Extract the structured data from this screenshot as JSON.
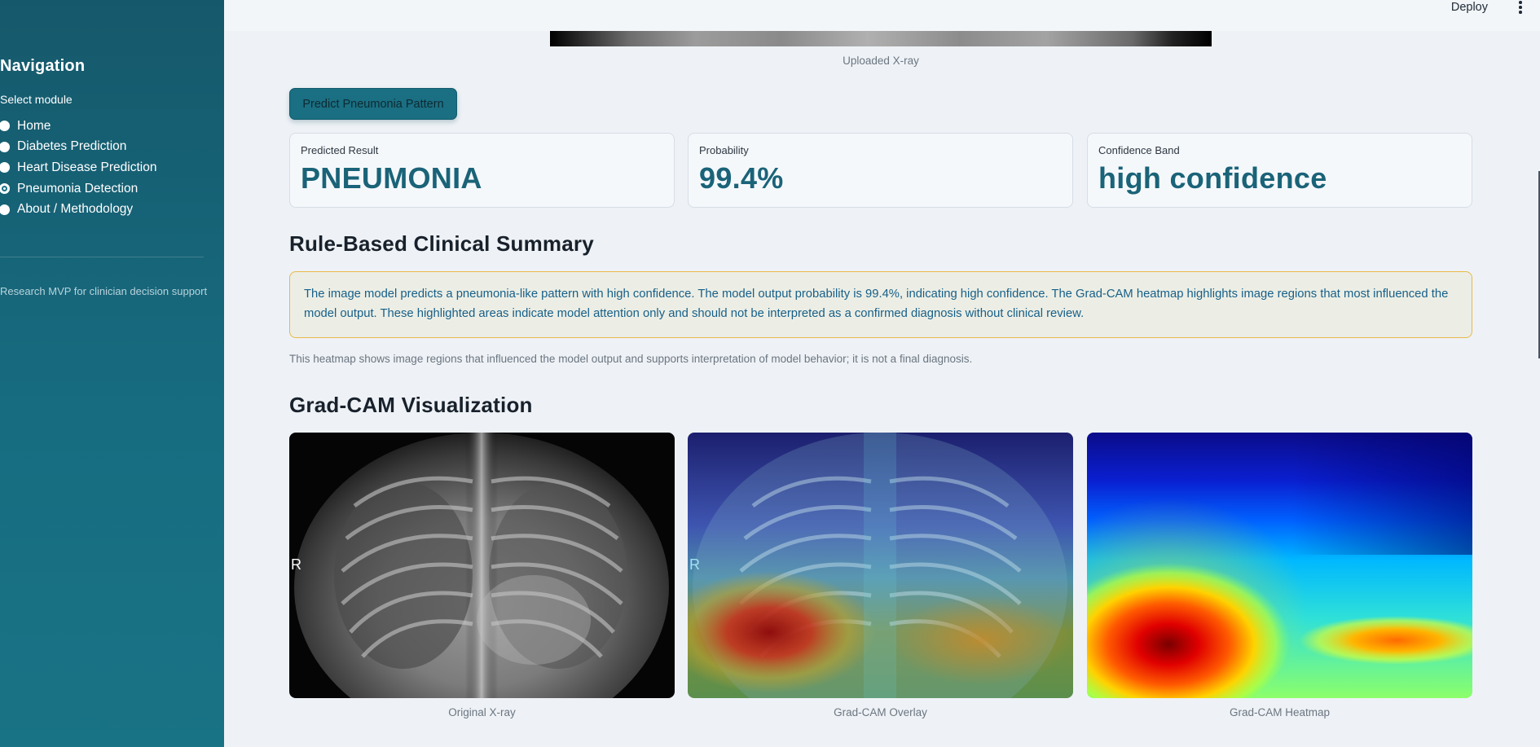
{
  "sidebar": {
    "title": "Navigation",
    "select_label": "Select module",
    "items": [
      {
        "label": "Home",
        "selected": false
      },
      {
        "label": "Diabetes Prediction",
        "selected": false
      },
      {
        "label": "Heart Disease Prediction",
        "selected": false
      },
      {
        "label": "Pneumonia Detection",
        "selected": true
      },
      {
        "label": "About / Methodology",
        "selected": false
      }
    ],
    "note": "Research MVP for clinician decision support"
  },
  "topbar": {
    "deploy_label": "Deploy",
    "menu_icon": "kebab-menu-icon"
  },
  "upload": {
    "caption": "Uploaded X-ray"
  },
  "predict_button": "Predict Pneumonia Pattern",
  "metrics": [
    {
      "label": "Predicted Result",
      "value": "PNEUMONIA"
    },
    {
      "label": "Probability",
      "value": "99.4%"
    },
    {
      "label": "Confidence Band",
      "value": "high confidence"
    }
  ],
  "summary": {
    "title": "Rule-Based Clinical Summary",
    "text": "The image model predicts a pneumonia-like pattern with high confidence. The model output probability is 99.4%, indicating high confidence. The Grad-CAM heatmap highlights image regions that most influenced the model output. These highlighted areas indicate model attention only and should not be interpreted as a confirmed diagnosis without clinical review."
  },
  "disclaimer": "This heatmap shows image regions that influenced the model output and supports interpretation of model behavior; it is not a final diagnosis.",
  "gradcam": {
    "title": "Grad-CAM Visualization",
    "marker": "R",
    "captions": [
      "Original X-ray",
      "Grad-CAM Overlay",
      "Grad-CAM Heatmap"
    ]
  },
  "colors": {
    "accent": "#1a6f82",
    "metric_value": "#1a6378",
    "summary_border": "#e9b848",
    "summary_text": "#175f88"
  }
}
